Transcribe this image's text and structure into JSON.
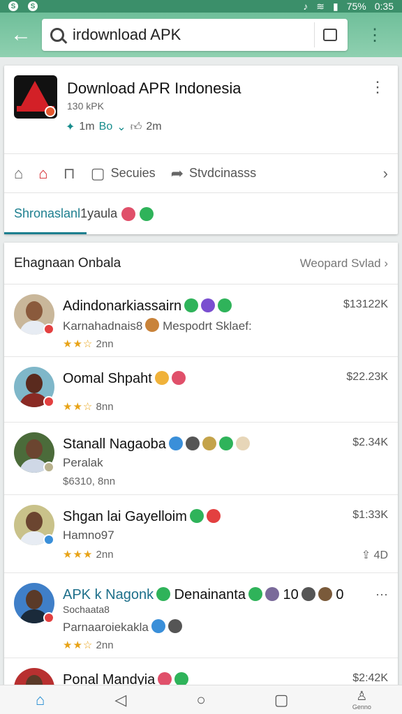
{
  "status_bar": {
    "left_icons": [
      "S",
      "S"
    ],
    "battery": "75%",
    "time": "0:35"
  },
  "search": {
    "query": "irdownload APK"
  },
  "app": {
    "title": "Download APR Indonesia",
    "subtitle": "130 kPK",
    "meta_a": "1m",
    "meta_b": "Bo",
    "meta_c": "2m"
  },
  "actions": {
    "item3_label": "Secuies",
    "item4_label": "Stvdcinasss"
  },
  "tabs": {
    "active": "Shronaslanl",
    "rest": "1yaula"
  },
  "list": {
    "title": "Ehagnaan Onbala",
    "action": "Weopard Svlad",
    "rows": [
      {
        "name": "Adindonarkiassairn",
        "line2": "Karnahadnais8",
        "line2b": "Mespodrt Sklaef:",
        "line3": "2nn",
        "stars": "★★☆",
        "price": "$13122K"
      },
      {
        "name": "Oomal Shpaht",
        "line2": "",
        "line3": "8nn",
        "stars": "★★☆",
        "price": "$22.23K"
      },
      {
        "name": "Stanall Nagaoba",
        "line2": "Peralak",
        "line3": "$6310, 8nn",
        "stars": "",
        "price": "$2.34K"
      },
      {
        "name": "Shgan lai Gayelloim",
        "line2": "Hamno97",
        "line3": "2nn",
        "stars": "★★★",
        "price": "$1:33K",
        "extra": "4D"
      },
      {
        "name": "APK k Nagonk",
        "name_b": "Denainanta",
        "name_c": "10",
        "name_d": "0",
        "line2": "Sochaata8",
        "line2b": "Parnaaroiekakla",
        "line3": "2nn",
        "stars": "★★☆",
        "price": ""
      },
      {
        "name": "Ponal Mandyia",
        "line2": "",
        "line3": "",
        "stars": "",
        "price": "$2:42K"
      }
    ]
  },
  "bottom_nav": {
    "last_label": "Genno"
  }
}
